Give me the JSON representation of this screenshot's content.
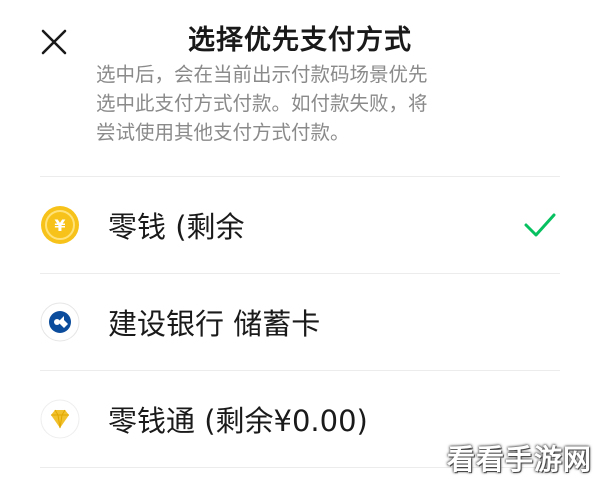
{
  "header": {
    "close_icon": "close-icon",
    "title": "选择优先支付方式",
    "description_lines": [
      "选中后，会在当前出示付款码场景优先",
      "选中此支付方式付款。如付款失败，将",
      "尝试使用其他支付方式付款。"
    ]
  },
  "payment_methods": [
    {
      "label": "零钱 (剩余",
      "icon": "coin-icon",
      "selected": true
    },
    {
      "label": "建设银行 储蓄卡",
      "icon": "ccb-bank-icon",
      "selected": false
    },
    {
      "label": "零钱通 (剩余¥0.00)",
      "icon": "diamond-icon",
      "selected": false
    }
  ],
  "watermark": "看看手游网",
  "colors": {
    "check_green": "#07C160",
    "coin_yellow": "#F7C31A",
    "ccb_blue": "#0B4C9C",
    "diamond_gold": "#F2C12E"
  }
}
